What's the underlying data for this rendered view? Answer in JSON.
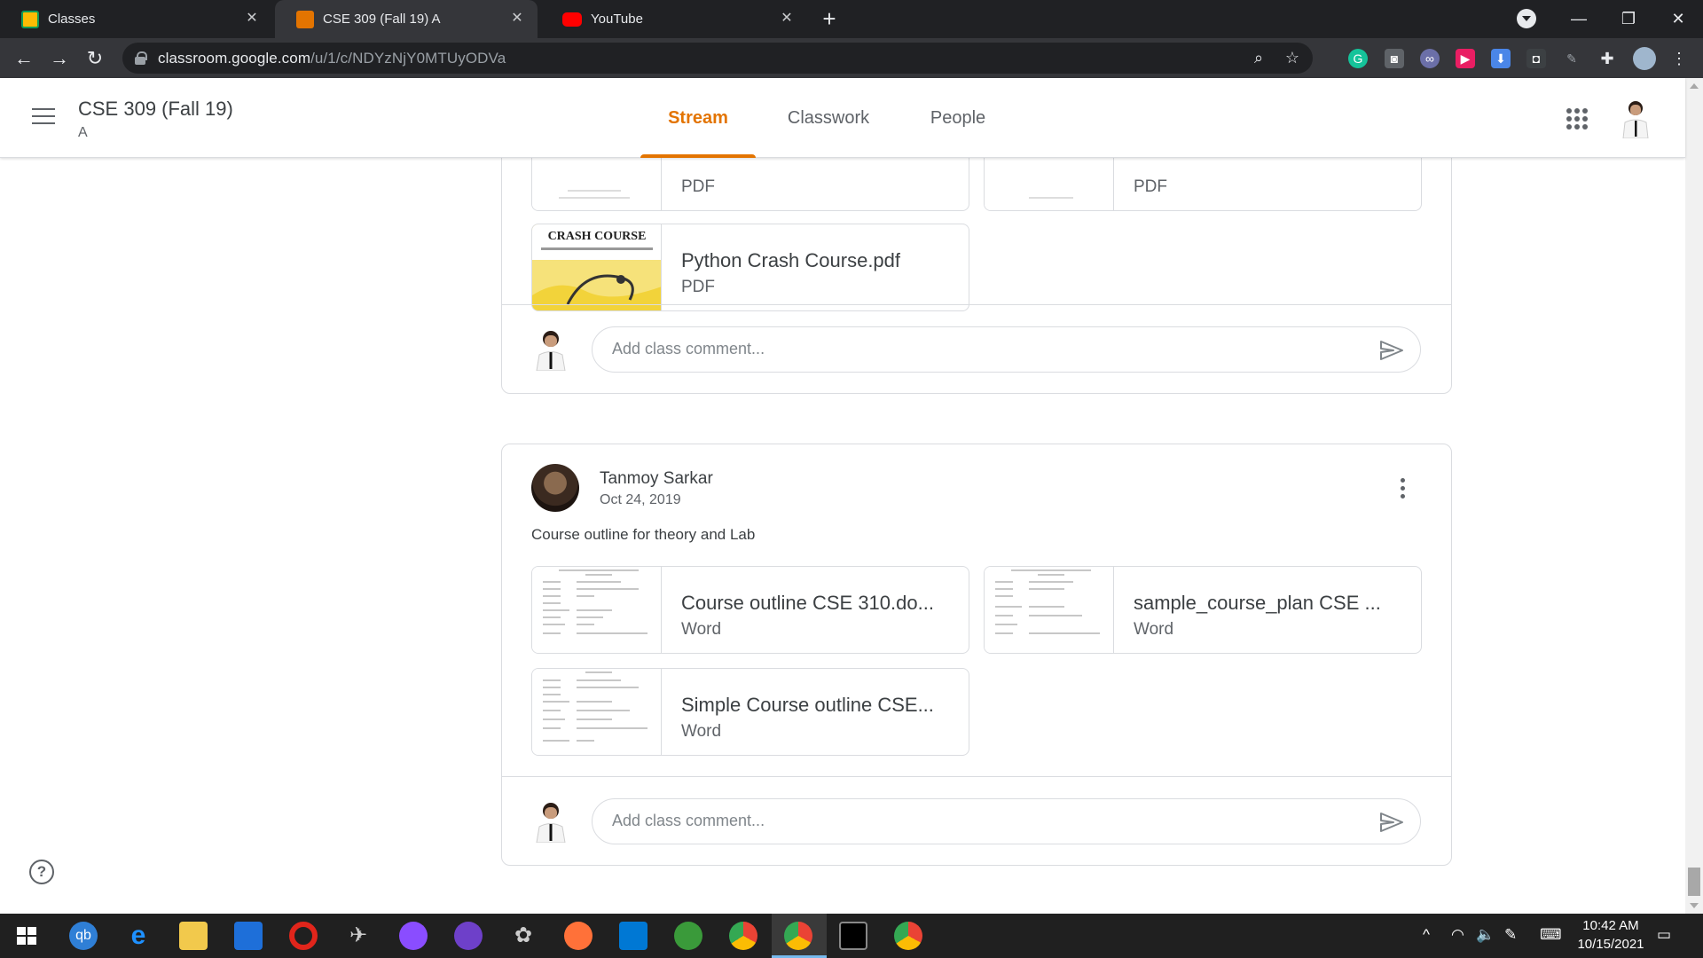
{
  "browser": {
    "tabs": [
      {
        "title": "Classes",
        "active": false,
        "favicon": "classroom-icon"
      },
      {
        "title": "CSE 309 (Fall 19) A",
        "active": true,
        "favicon": "classroom-icon"
      },
      {
        "title": "YouTube",
        "active": false,
        "favicon": "youtube-icon"
      }
    ],
    "url_main": "classroom.google.com",
    "url_path": "/u/1/c/NDYzNjY0MTUyODVa"
  },
  "classroom": {
    "class_title": "CSE 309 (Fall 19)",
    "section": "A",
    "nav_tabs": [
      "Stream",
      "Classwork",
      "People"
    ],
    "active_tab": "Stream"
  },
  "post1": {
    "attachments": [
      {
        "title": "",
        "type": "PDF"
      },
      {
        "title": "",
        "type": "PDF"
      },
      {
        "title": "Python Crash Course.pdf",
        "type": "PDF"
      }
    ],
    "thumb_cover_text": "CRASH COURSE",
    "comment_placeholder": "Add class comment..."
  },
  "post2": {
    "author": "Tanmoy Sarkar",
    "date": "Oct 24, 2019",
    "text": "Course outline for theory and Lab",
    "attachments": [
      {
        "title": "Course outline CSE 310.do...",
        "type": "Word"
      },
      {
        "title": "sample_course_plan CSE ...",
        "type": "Word"
      },
      {
        "title": "Simple Course outline CSE...",
        "type": "Word"
      }
    ],
    "comment_placeholder": "Add class comment..."
  },
  "taskbar": {
    "time": "10:42 AM",
    "date": "10/15/2021"
  },
  "colors": {
    "accent": "#e37400",
    "browser_dark": "#202124",
    "toolbar": "#35363a"
  }
}
